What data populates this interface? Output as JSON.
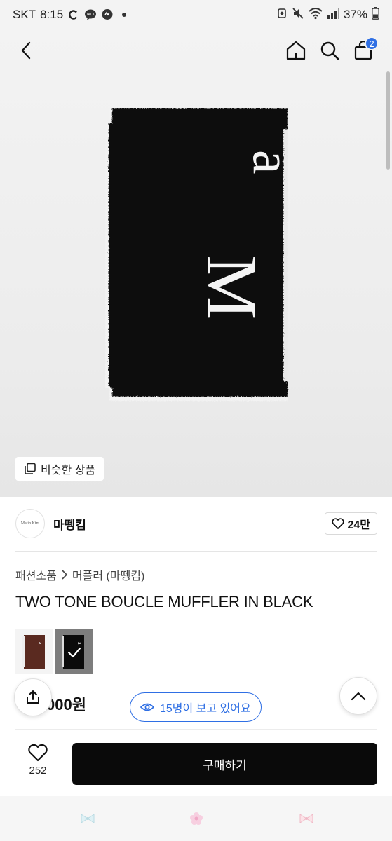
{
  "status_bar": {
    "carrier": "SKT",
    "time": "8:15",
    "battery": "37%",
    "icons": [
      "c-icon",
      "talk-icon",
      "chat-icon",
      "dot-icon",
      "recycle-icon",
      "mute-icon",
      "wifi-icon",
      "signal-icon",
      "battery-icon"
    ]
  },
  "header": {
    "back_icon": "chevron-left-icon",
    "home_icon": "home-icon",
    "search_icon": "search-icon",
    "cart_icon": "shopping-bag-icon",
    "cart_count": "2"
  },
  "hero": {
    "similar_products_label": "비슷한 상품",
    "similar_icon": "copy-icon"
  },
  "shop": {
    "logo_text": "Matin Kim",
    "name": "마뗑킴",
    "likes": "24만"
  },
  "product": {
    "breadcrumb": [
      "패션소품",
      "머플러 (마뗑킴)"
    ],
    "title": "TWO TONE BOUCLE MUFFLER IN BLACK",
    "price_visible": "000원",
    "viewers_text": "15명이 보고 있어요",
    "variants": [
      {
        "color": "#5a2a20",
        "selected": false
      },
      {
        "color": "#0b0b0b",
        "selected": true
      }
    ]
  },
  "action_bar": {
    "wish_count": "252",
    "buy_label": "구매하기"
  },
  "colors": {
    "accent": "#2f6fe4",
    "buy_button": "#0a0a0a",
    "scarf": "#0b0b0b",
    "scarf_trim": "#f2f2f2"
  }
}
